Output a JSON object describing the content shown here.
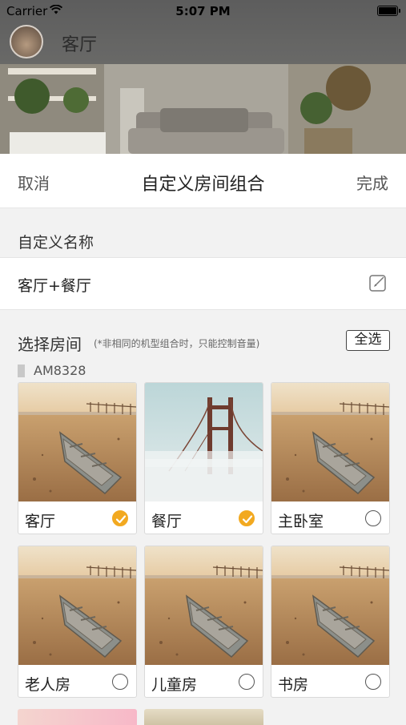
{
  "status_bar": {
    "carrier": "Carrier",
    "time": "5:07 PM"
  },
  "background_room": {
    "title": "客厅"
  },
  "sheet": {
    "cancel_label": "取消",
    "title": "自定义房间组合",
    "done_label": "完成",
    "name_section_label": "自定义名称",
    "name_value": "客厅+餐厅",
    "select_section_label": "选择房间",
    "select_hint": "(*非相同的机型组合时，只能控制音量)",
    "select_all_label": "全选",
    "model_name": "AM8328"
  },
  "rooms": [
    {
      "name": "客厅",
      "selected": true,
      "photo": "boat-on-beach"
    },
    {
      "name": "餐厅",
      "selected": true,
      "photo": "golden-gate-fog"
    },
    {
      "name": "主卧室",
      "selected": false,
      "photo": "boat-on-beach"
    },
    {
      "name": "老人房",
      "selected": false,
      "photo": "boat-on-beach"
    },
    {
      "name": "儿童房",
      "selected": false,
      "photo": "boat-on-beach"
    },
    {
      "name": "书房",
      "selected": false,
      "photo": "boat-on-beach"
    }
  ],
  "colors": {
    "check_on": "#f2a920",
    "accent_text": "#222222"
  }
}
